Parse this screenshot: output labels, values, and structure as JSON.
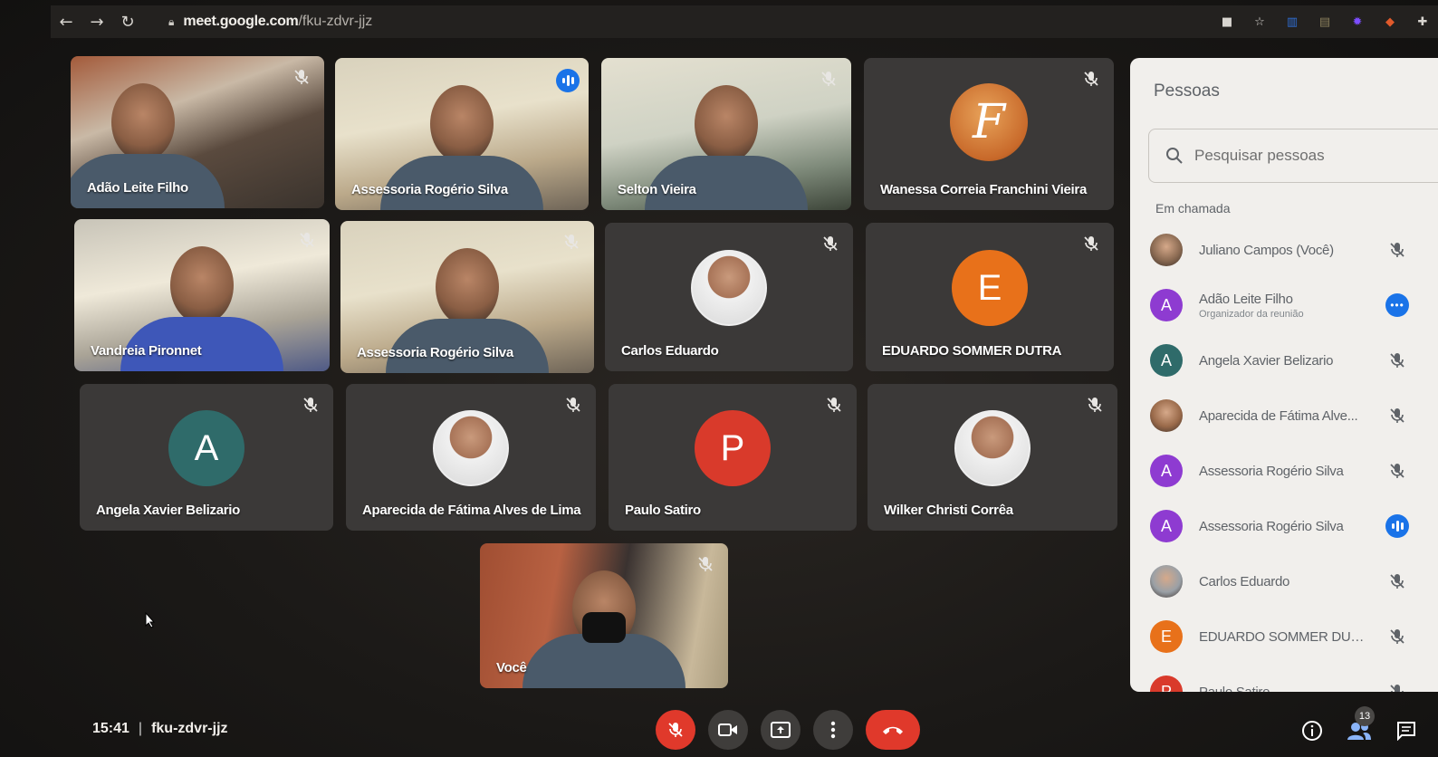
{
  "browser": {
    "url_host": "meet.google.com",
    "url_path": "/fku-zdvr-jjz",
    "extensions": [
      {
        "name": "camera-icon",
        "color": "#d8d5d0"
      },
      {
        "name": "star-icon",
        "color": "#d8d5d0"
      },
      {
        "name": "trello-icon",
        "color": "#2f6fd6"
      },
      {
        "name": "code-icon",
        "color": "#8a7f5c"
      },
      {
        "name": "purple-star-icon",
        "color": "#7c4dff"
      },
      {
        "name": "color-wheel-icon",
        "color": "#e05a2b"
      },
      {
        "name": "puzzle-icon",
        "color": "#d8d5d0"
      }
    ]
  },
  "tiles": [
    {
      "name": "Adão Leite Filho",
      "kind": "video",
      "scene": "office"
    },
    {
      "name": "Assessoria Rogério Silva",
      "kind": "video",
      "scene": "room",
      "speaking": true
    },
    {
      "name": "Selton Vieira",
      "kind": "video",
      "scene": "room2"
    },
    {
      "name": "Wanessa Correia Franchini Vieira",
      "kind": "logo",
      "letter": "F"
    },
    {
      "name": "Vandreia Pironnet",
      "kind": "video",
      "scene": "home"
    },
    {
      "name": "Assessoria Rogério Silva",
      "kind": "video",
      "scene": "room"
    },
    {
      "name": "Carlos Eduardo",
      "kind": "photo"
    },
    {
      "name": "EDUARDO SOMMER DUTRA",
      "kind": "letter",
      "letter": "E",
      "color": "#e8711a"
    },
    {
      "name": "Angela Xavier Belizario",
      "kind": "letter",
      "letter": "A",
      "color": "#2f6b6a"
    },
    {
      "name": "Aparecida de Fátima Alves de Lima",
      "kind": "photo"
    },
    {
      "name": "Paulo Satiro",
      "kind": "letter",
      "letter": "P",
      "color": "#d93a2b"
    },
    {
      "name": "Wilker Christi Corrêa",
      "kind": "photo"
    },
    {
      "name": "Você",
      "kind": "video",
      "scene": "self"
    }
  ],
  "bottom": {
    "time": "15:41",
    "meeting_code": "fku-zdvr-jjz",
    "participant_count": "13"
  },
  "people_panel": {
    "title": "Pessoas",
    "search_placeholder": "Pesquisar pessoas",
    "section_label": "Em chamada",
    "people": [
      {
        "name": "Juliano Campos (Você)",
        "avatar": "photo",
        "color": "#8a6a52",
        "status": "muted"
      },
      {
        "name": "Adão Leite Filho",
        "subtitle": "Organizador da reunião",
        "avatar": "A",
        "color": "#8e3bd1",
        "status": "more"
      },
      {
        "name": "Angela Xavier Belizario",
        "avatar": "A",
        "color": "#2f6b6a",
        "status": "muted"
      },
      {
        "name": "Aparecida de Fátima Alve...",
        "avatar": "photo",
        "color": "#9a6a4a",
        "status": "muted"
      },
      {
        "name": "Assessoria Rogério Silva",
        "avatar": "A",
        "color": "#8e3bd1",
        "status": "muted"
      },
      {
        "name": "Assessoria Rogério Silva",
        "avatar": "A",
        "color": "#8e3bd1",
        "status": "speaking"
      },
      {
        "name": "Carlos Eduardo",
        "avatar": "photo",
        "color": "#9aa0a6",
        "status": "muted"
      },
      {
        "name": "EDUARDO SOMMER DUT...",
        "avatar": "E",
        "color": "#e8711a",
        "status": "muted"
      },
      {
        "name": "Paulo Satiro",
        "avatar": "P",
        "color": "#d93a2b",
        "status": "muted"
      }
    ]
  }
}
